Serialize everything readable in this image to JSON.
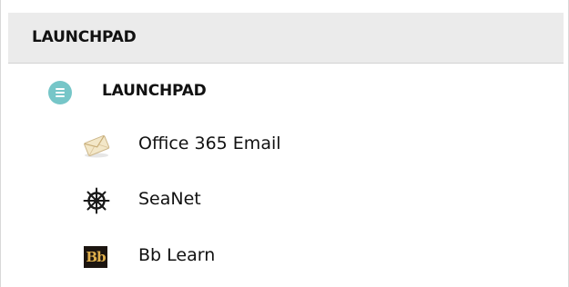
{
  "header": {
    "title": "LAUNCHPAD"
  },
  "group": {
    "title": "LAUNCHPAD",
    "icon": "list-circle-icon",
    "icon_color": "#76c6c8"
  },
  "items": [
    {
      "label": "Office 365 Email",
      "icon": "envelope-icon"
    },
    {
      "label": "SeaNet",
      "icon": "ship-wheel-icon"
    },
    {
      "label": "Bb Learn",
      "icon": "blackboard-logo-icon",
      "icon_text": "Bb"
    }
  ],
  "colors": {
    "header_bg": "#ebebeb",
    "text": "#111111",
    "bb_bg": "#1c1510",
    "bb_text": "#e0b04c"
  }
}
